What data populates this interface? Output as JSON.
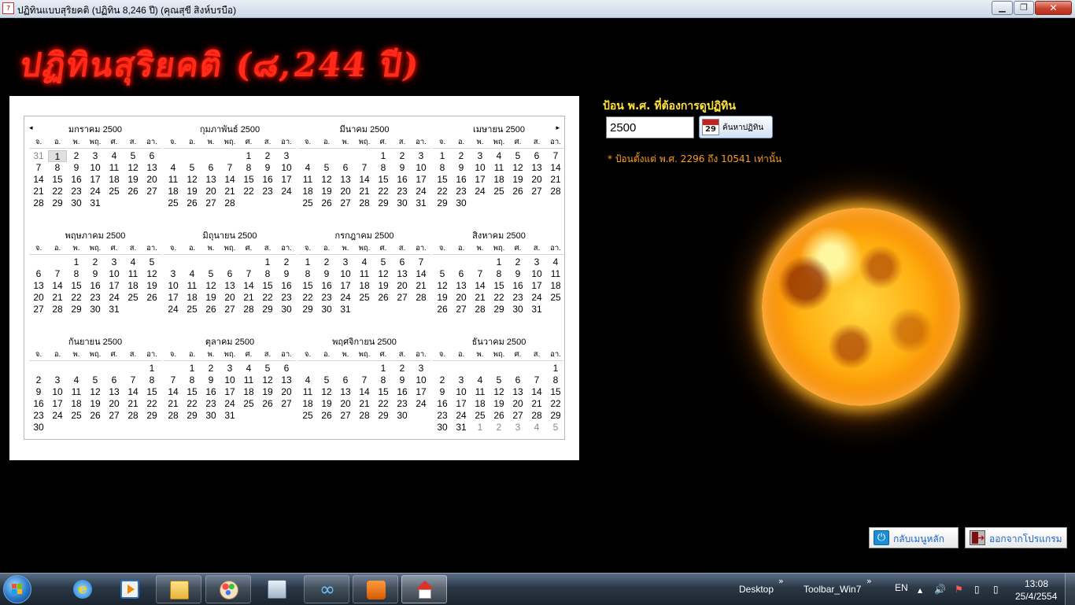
{
  "window": {
    "title": "ปฏิทินแบบสุริยคติ (ปฏิทิน 8,246 ปี) (คุณสุขี สิงห์บรบือ)",
    "icon_text": "7",
    "min_glyph": "▁",
    "max_glyph": "❐",
    "close_glyph": "✕"
  },
  "header": {
    "title": "ปฏิทินสุริยคติ (๘,244 ปี)"
  },
  "calendar": {
    "prev_arrow": "◂",
    "next_arrow": "▸",
    "weekday_headers": [
      "จ.",
      "อ.",
      "พ.",
      "พฤ.",
      "ศ.",
      "ส.",
      "อา."
    ],
    "months": [
      {
        "title": "มกราคม 2500",
        "weeks": [
          [
            "31",
            "1",
            "2",
            "3",
            "4",
            "5",
            "6"
          ],
          [
            "7",
            "8",
            "9",
            "10",
            "11",
            "12",
            "13"
          ],
          [
            "14",
            "15",
            "16",
            "17",
            "18",
            "19",
            "20"
          ],
          [
            "21",
            "22",
            "23",
            "24",
            "25",
            "26",
            "27"
          ],
          [
            "28",
            "29",
            "30",
            "31",
            "",
            "",
            ""
          ]
        ],
        "other_days": [
          "0-0"
        ],
        "selected_days": [
          "0-1"
        ]
      },
      {
        "title": "กุมภาพันธ์ 2500",
        "weeks": [
          [
            "",
            "",
            "",
            "",
            "1",
            "2",
            "3"
          ],
          [
            "4",
            "5",
            "6",
            "7",
            "8",
            "9",
            "10"
          ],
          [
            "11",
            "12",
            "13",
            "14",
            "15",
            "16",
            "17"
          ],
          [
            "18",
            "19",
            "20",
            "21",
            "22",
            "23",
            "24"
          ],
          [
            "25",
            "26",
            "27",
            "28",
            "",
            "",
            ""
          ]
        ]
      },
      {
        "title": "มีนาคม 2500",
        "weeks": [
          [
            "",
            "",
            "",
            "",
            "1",
            "2",
            "3"
          ],
          [
            "4",
            "5",
            "6",
            "7",
            "8",
            "9",
            "10"
          ],
          [
            "11",
            "12",
            "13",
            "14",
            "15",
            "16",
            "17"
          ],
          [
            "18",
            "19",
            "20",
            "21",
            "22",
            "23",
            "24"
          ],
          [
            "25",
            "26",
            "27",
            "28",
            "29",
            "30",
            "31"
          ]
        ]
      },
      {
        "title": "เมษายน 2500",
        "weeks": [
          [
            "1",
            "2",
            "3",
            "4",
            "5",
            "6",
            "7"
          ],
          [
            "8",
            "9",
            "10",
            "11",
            "12",
            "13",
            "14"
          ],
          [
            "15",
            "16",
            "17",
            "18",
            "19",
            "20",
            "21"
          ],
          [
            "22",
            "23",
            "24",
            "25",
            "26",
            "27",
            "28"
          ],
          [
            "29",
            "30",
            "",
            "",
            "",
            "",
            ""
          ]
        ]
      },
      {
        "title": "พฤษภาคม 2500",
        "weeks": [
          [
            "",
            "",
            "1",
            "2",
            "3",
            "4",
            "5"
          ],
          [
            "6",
            "7",
            "8",
            "9",
            "10",
            "11",
            "12"
          ],
          [
            "13",
            "14",
            "15",
            "16",
            "17",
            "18",
            "19"
          ],
          [
            "20",
            "21",
            "22",
            "23",
            "24",
            "25",
            "26"
          ],
          [
            "27",
            "28",
            "29",
            "30",
            "31",
            "",
            ""
          ]
        ]
      },
      {
        "title": "มิถุนายน 2500",
        "weeks": [
          [
            "",
            "",
            "",
            "",
            "",
            "1",
            "2"
          ],
          [
            "3",
            "4",
            "5",
            "6",
            "7",
            "8",
            "9"
          ],
          [
            "10",
            "11",
            "12",
            "13",
            "14",
            "15",
            "16"
          ],
          [
            "17",
            "18",
            "19",
            "20",
            "21",
            "22",
            "23"
          ],
          [
            "24",
            "25",
            "26",
            "27",
            "28",
            "29",
            "30"
          ]
        ]
      },
      {
        "title": "กรกฎาคม 2500",
        "weeks": [
          [
            "1",
            "2",
            "3",
            "4",
            "5",
            "6",
            "7"
          ],
          [
            "8",
            "9",
            "10",
            "11",
            "12",
            "13",
            "14"
          ],
          [
            "15",
            "16",
            "17",
            "18",
            "19",
            "20",
            "21"
          ],
          [
            "22",
            "23",
            "24",
            "25",
            "26",
            "27",
            "28"
          ],
          [
            "29",
            "30",
            "31",
            "",
            "",
            "",
            ""
          ]
        ]
      },
      {
        "title": "สิงหาคม 2500",
        "weeks": [
          [
            "",
            "",
            "",
            "1",
            "2",
            "3",
            "4"
          ],
          [
            "5",
            "6",
            "7",
            "8",
            "9",
            "10",
            "11"
          ],
          [
            "12",
            "13",
            "14",
            "15",
            "16",
            "17",
            "18"
          ],
          [
            "19",
            "20",
            "21",
            "22",
            "23",
            "24",
            "25"
          ],
          [
            "26",
            "27",
            "28",
            "29",
            "30",
            "31",
            ""
          ]
        ]
      },
      {
        "title": "กันยายน 2500",
        "weeks": [
          [
            "",
            "",
            "",
            "",
            "",
            "",
            "1"
          ],
          [
            "2",
            "3",
            "4",
            "5",
            "6",
            "7",
            "8"
          ],
          [
            "9",
            "10",
            "11",
            "12",
            "13",
            "14",
            "15"
          ],
          [
            "16",
            "17",
            "18",
            "19",
            "20",
            "21",
            "22"
          ],
          [
            "23",
            "24",
            "25",
            "26",
            "27",
            "28",
            "29"
          ],
          [
            "30",
            "",
            "",
            "",
            "",
            "",
            ""
          ]
        ]
      },
      {
        "title": "ตุลาคม 2500",
        "weeks": [
          [
            "",
            "1",
            "2",
            "3",
            "4",
            "5",
            "6"
          ],
          [
            "7",
            "8",
            "9",
            "10",
            "11",
            "12",
            "13"
          ],
          [
            "14",
            "15",
            "16",
            "17",
            "18",
            "19",
            "20"
          ],
          [
            "21",
            "22",
            "23",
            "24",
            "25",
            "26",
            "27"
          ],
          [
            "28",
            "29",
            "30",
            "31",
            "",
            "",
            ""
          ]
        ]
      },
      {
        "title": "พฤศจิกายน 2500",
        "weeks": [
          [
            "",
            "",
            "",
            "",
            "1",
            "2",
            "3"
          ],
          [
            "4",
            "5",
            "6",
            "7",
            "8",
            "9",
            "10"
          ],
          [
            "11",
            "12",
            "13",
            "14",
            "15",
            "16",
            "17"
          ],
          [
            "18",
            "19",
            "20",
            "21",
            "22",
            "23",
            "24"
          ],
          [
            "25",
            "26",
            "27",
            "28",
            "29",
            "30",
            ""
          ]
        ]
      },
      {
        "title": "ธันวาคม 2500",
        "weeks": [
          [
            "",
            "",
            "",
            "",
            "",
            "",
            "1"
          ],
          [
            "2",
            "3",
            "4",
            "5",
            "6",
            "7",
            "8"
          ],
          [
            "9",
            "10",
            "11",
            "12",
            "13",
            "14",
            "15"
          ],
          [
            "16",
            "17",
            "18",
            "19",
            "20",
            "21",
            "22"
          ],
          [
            "23",
            "24",
            "25",
            "26",
            "27",
            "28",
            "29"
          ],
          [
            "30",
            "31",
            "1",
            "2",
            "3",
            "4",
            "5"
          ]
        ],
        "other_days": [
          "5-2",
          "5-3",
          "5-4",
          "5-5",
          "5-6"
        ]
      }
    ]
  },
  "year_form": {
    "prompt": "ป้อน พ.ศ. ที่ต้องการดูปฏิทิน",
    "year_value": "2500",
    "search_button_label": "ค้นหาปฏิทิน",
    "search_button_icon": "calendar-icon",
    "search_icon_number": "29",
    "range_note": "* ป้อนตั้งแต่ พ.ศ. 2296 ถึง 10541 เท่านั้น"
  },
  "buttons": {
    "back_menu_label": "กลับเมนูหลัก",
    "back_menu_icon": "power-icon",
    "power_glyph": "⏻",
    "exit_label": "ออกจากโปรแกรม",
    "exit_icon": "exit-door-icon",
    "exit_glyph": "➜"
  },
  "taskbar": {
    "ie_glyph": "e",
    "infinity_glyph": "∞",
    "chevron": "»",
    "desktop_label": "Desktop",
    "toolbar_label": "Toolbar_Win7",
    "language": "EN",
    "tray_up_glyph": "▲",
    "volume_glyph": "🔊",
    "flag_glyph": "⚑",
    "network_glyph": "▯",
    "time": "13:08",
    "date": "25/4/2554"
  },
  "colors": {
    "header_red": "#ff2a1a",
    "prompt_yellow": "#ffe23a",
    "note_orange": "#ff9f1a",
    "button_label_blue": "#1a66cc"
  }
}
